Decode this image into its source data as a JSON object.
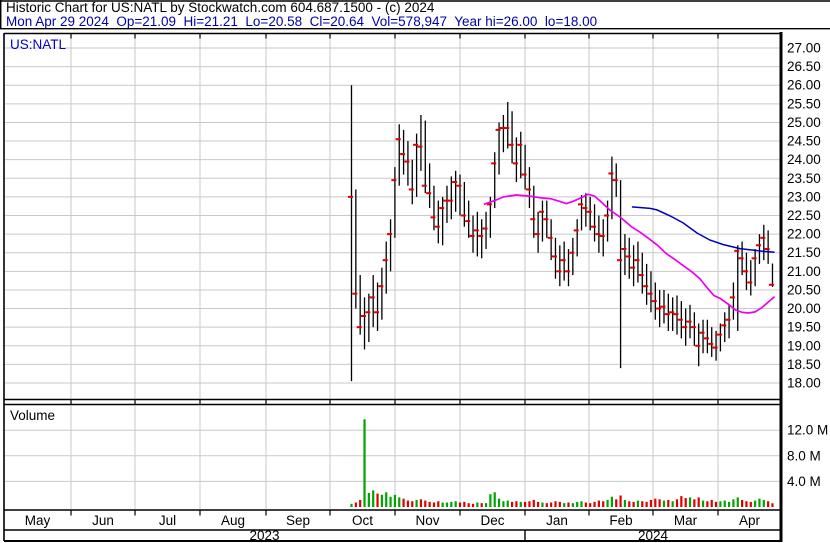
{
  "header": {
    "line1": "Historic Chart for US:NATL by Stockwatch.com 604.687.1500 - (c) 2024",
    "line2": "Mon Apr 29 2024  Op=21.09  Hi=21.21  Lo=20.58  Cl=20.64  Vol=578,947  Year hi=26.00  lo=18.00"
  },
  "chart": {
    "symbol_label": "US:NATL",
    "volume_label": "Volume"
  },
  "colors": {
    "header_line1": "#000000",
    "header_line2": "#0000A8",
    "symbol": "#0000C8",
    "grid": "#C9C9C9",
    "border": "#000000",
    "bar": "#000000",
    "close_tick": "#DD0000",
    "ma_short": "#EE00EE",
    "ma_long": "#0000BB",
    "vol_up": "#00A400",
    "vol_down": "#DC0000",
    "label": "#000000"
  },
  "chart_data": {
    "type": "hlc-bars-with-volume",
    "title": "Historic Chart for US:NATL by Stockwatch.com 604.687.1500 - (c) 2024",
    "subtitle": "Mon Apr 29 2024  Op=21.09  Hi=21.21  Lo=20.58  Cl=20.64  Vol=578,947  Year hi=26.00  lo=18.00",
    "last_quote": {
      "date": "Mon Apr 29 2024",
      "open": 21.09,
      "high": 21.21,
      "low": 20.58,
      "close": 20.64,
      "volume": "578,947",
      "year_high": 26.0,
      "year_low": 18.0
    },
    "price_axis": {
      "min": 18.0,
      "max": 27.0,
      "step": 0.5,
      "side": "right",
      "grid": true
    },
    "volume_axis": {
      "unit": "millions",
      "ticks": [
        {
          "label": "12.0 M",
          "value": 12
        },
        {
          "label": "8.0 M",
          "value": 8
        },
        {
          "label": "4.0 M",
          "value": 4
        }
      ]
    },
    "months": [
      "May",
      "Jun",
      "Jul",
      "Aug",
      "Sep",
      "Oct",
      "Nov",
      "Dec",
      "Jan",
      "Feb",
      "Mar",
      "Apr"
    ],
    "years": [
      {
        "label": "2023",
        "from_month": 0,
        "to_month": 8
      },
      {
        "label": "2024",
        "from_month": 8,
        "to_month": 12
      }
    ],
    "series_note": "trading begins early Oct 2023; bars are high/low lines with red close tick",
    "bars_hi_lo_close": [
      [
        26,
        18.05,
        23
      ],
      [
        23.2,
        20,
        20.4
      ],
      [
        20.9,
        19.3,
        19.5
      ],
      [
        20.3,
        18.9,
        19.8
      ],
      [
        20.4,
        19.1,
        19.9
      ],
      [
        20.9,
        19.5,
        20.3
      ],
      [
        20.7,
        19.4,
        19.9
      ],
      [
        21.1,
        19.7,
        20.6
      ],
      [
        21.8,
        20.4,
        21.3
      ],
      [
        22.4,
        21,
        22
      ],
      [
        23.8,
        21.9,
        23.45
      ],
      [
        24.95,
        23.3,
        24.55
      ],
      [
        24.8,
        23.6,
        24.15
      ],
      [
        24.5,
        23.3,
        23.95
      ],
      [
        24,
        22.8,
        23.2
      ],
      [
        24.7,
        23,
        24.4
      ],
      [
        25.2,
        23.7,
        24.35
      ],
      [
        25.05,
        23.1,
        23.3
      ],
      [
        23.9,
        22.7,
        23.1
      ],
      [
        23.3,
        22.1,
        22.45
      ],
      [
        22.9,
        21.75,
        22.2
      ],
      [
        23,
        21.7,
        22.7
      ],
      [
        23.3,
        22.3,
        22.9
      ],
      [
        23.55,
        22.4,
        22.9
      ],
      [
        23.7,
        22.6,
        23.4
      ],
      [
        23.6,
        22.5,
        23.3
      ],
      [
        23.4,
        22.2,
        22.5
      ],
      [
        22.9,
        21.9,
        22.35
      ],
      [
        22.5,
        21.5,
        21.95
      ],
      [
        22.6,
        21.4,
        22.1
      ],
      [
        22.4,
        21.35,
        21.95
      ],
      [
        22.6,
        21.6,
        22.15
      ],
      [
        23,
        21.9,
        22.8
      ],
      [
        24.2,
        22.7,
        23.9
      ],
      [
        25,
        23.6,
        24.8
      ],
      [
        25.2,
        24.2,
        24.85
      ],
      [
        25.55,
        24.3,
        24.85
      ],
      [
        25.3,
        23.9,
        24.4
      ],
      [
        24.6,
        23.4,
        23.9
      ],
      [
        24.75,
        23.5,
        24.4
      ],
      [
        24.4,
        23.2,
        23.6
      ],
      [
        23.8,
        22.7,
        23.2
      ],
      [
        23.3,
        21.9,
        22.4
      ],
      [
        22.6,
        21.5,
        22
      ],
      [
        22.9,
        21.8,
        22.6
      ],
      [
        22.9,
        21.9,
        22.4
      ],
      [
        22.4,
        21.3,
        21.9
      ],
      [
        21.9,
        20.8,
        21.4
      ],
      [
        21.7,
        20.6,
        21
      ],
      [
        21.8,
        20.75,
        21.3
      ],
      [
        21.6,
        20.6,
        21
      ],
      [
        21.9,
        20.9,
        21.5
      ],
      [
        22.4,
        21.4,
        22.1
      ],
      [
        23.05,
        22.1,
        22.8
      ],
      [
        23.1,
        22.2,
        22.7
      ],
      [
        23,
        22.1,
        22.6
      ],
      [
        22.8,
        21.8,
        22.2
      ],
      [
        22.5,
        21.5,
        22
      ],
      [
        22.4,
        21.4,
        21.95
      ],
      [
        22.9,
        21.8,
        22.5
      ],
      [
        24.08,
        22.4,
        23.63
      ],
      [
        23.9,
        23,
        23.45
      ],
      [
        23.45,
        18.4,
        21.3
      ],
      [
        22,
        20.9,
        21.6
      ],
      [
        21.9,
        20.8,
        21.4
      ],
      [
        21.7,
        20.6,
        21.1
      ],
      [
        21.8,
        20.7,
        21.3
      ],
      [
        21.5,
        20.4,
        20.9
      ],
      [
        21.2,
        20.1,
        20.6
      ],
      [
        21,
        19.9,
        20.4
      ],
      [
        20.7,
        19.7,
        20.2
      ],
      [
        20.5,
        19.5,
        20
      ],
      [
        20.5,
        19.6,
        20.05
      ],
      [
        20.4,
        19.4,
        19.85
      ],
      [
        20.3,
        19.4,
        19.9
      ],
      [
        20.35,
        19.3,
        19.85
      ],
      [
        20.2,
        19.2,
        19.7
      ],
      [
        20,
        19,
        19.5
      ],
      [
        20.1,
        19.2,
        19.65
      ],
      [
        19.9,
        19,
        19.5
      ],
      [
        19.6,
        18.45,
        19
      ],
      [
        19.7,
        18.8,
        19.35
      ],
      [
        19.7,
        18.8,
        19.2
      ],
      [
        19.5,
        18.7,
        19.05
      ],
      [
        19.4,
        18.6,
        18.95
      ],
      [
        19.6,
        18.85,
        19.3
      ],
      [
        19.9,
        19.1,
        19.55
      ],
      [
        20.1,
        19.2,
        19.7
      ],
      [
        20.7,
        19.7,
        20.3
      ],
      [
        21.7,
        19.4,
        21.55
      ],
      [
        21.8,
        20.9,
        21.35
      ],
      [
        21.5,
        20.5,
        21
      ],
      [
        21.3,
        20.35,
        20.7
      ],
      [
        21.6,
        20.6,
        21.35
      ],
      [
        22,
        21.2,
        21.7
      ],
      [
        22.25,
        21.3,
        21.9
      ],
      [
        22.1,
        21.2,
        21.6
      ],
      [
        21.21,
        20.58,
        20.64
      ]
    ],
    "volumes_millions_dir": [
      [
        0.5,
        1
      ],
      [
        0.7,
        0
      ],
      [
        1.1,
        0
      ],
      [
        13.7,
        1
      ],
      [
        2.2,
        1
      ],
      [
        2.6,
        1
      ],
      [
        2.1,
        0
      ],
      [
        1.9,
        1
      ],
      [
        2.3,
        1
      ],
      [
        1.6,
        1
      ],
      [
        1.9,
        1
      ],
      [
        1.5,
        1
      ],
      [
        1.3,
        0
      ],
      [
        1,
        0
      ],
      [
        0.9,
        0
      ],
      [
        1.1,
        1
      ],
      [
        1.2,
        0
      ],
      [
        1,
        0
      ],
      [
        0.8,
        0
      ],
      [
        0.7,
        0
      ],
      [
        0.9,
        0
      ],
      [
        0.7,
        1
      ],
      [
        0.7,
        1
      ],
      [
        0.8,
        1
      ],
      [
        0.9,
        1
      ],
      [
        0.7,
        0
      ],
      [
        0.8,
        0
      ],
      [
        0.6,
        0
      ],
      [
        0.5,
        0
      ],
      [
        0.7,
        1
      ],
      [
        0.6,
        0
      ],
      [
        0.6,
        1
      ],
      [
        2,
        1
      ],
      [
        2.3,
        1
      ],
      [
        1.3,
        1
      ],
      [
        0.9,
        1
      ],
      [
        1,
        1
      ],
      [
        0.8,
        0
      ],
      [
        0.9,
        0
      ],
      [
        0.8,
        1
      ],
      [
        0.8,
        0
      ],
      [
        0.9,
        0
      ],
      [
        1.1,
        0
      ],
      [
        0.8,
        0
      ],
      [
        0.7,
        1
      ],
      [
        0.6,
        0
      ],
      [
        0.7,
        0
      ],
      [
        0.9,
        0
      ],
      [
        0.8,
        0
      ],
      [
        0.6,
        1
      ],
      [
        0.7,
        0
      ],
      [
        0.6,
        1
      ],
      [
        0.8,
        1
      ],
      [
        0.9,
        1
      ],
      [
        0.7,
        0
      ],
      [
        0.6,
        0
      ],
      [
        0.8,
        0
      ],
      [
        1,
        0
      ],
      [
        0.9,
        0
      ],
      [
        1.1,
        1
      ],
      [
        1.6,
        1
      ],
      [
        1.2,
        0
      ],
      [
        1.8,
        0
      ],
      [
        1.1,
        1
      ],
      [
        0.9,
        0
      ],
      [
        0.8,
        0
      ],
      [
        1,
        1
      ],
      [
        0.9,
        0
      ],
      [
        0.8,
        0
      ],
      [
        1.1,
        0
      ],
      [
        1.3,
        0
      ],
      [
        1.2,
        0
      ],
      [
        1,
        1
      ],
      [
        1.1,
        0
      ],
      [
        0.9,
        1
      ],
      [
        1.2,
        0
      ],
      [
        1.7,
        0
      ],
      [
        1.4,
        0
      ],
      [
        1.5,
        1
      ],
      [
        1.2,
        0
      ],
      [
        1.5,
        0
      ],
      [
        1,
        1
      ],
      [
        0.9,
        0
      ],
      [
        1.1,
        0
      ],
      [
        0.8,
        0
      ],
      [
        0.9,
        1
      ],
      [
        1,
        1
      ],
      [
        0.8,
        1
      ],
      [
        1.2,
        1
      ],
      [
        1.5,
        1
      ],
      [
        1.1,
        0
      ],
      [
        0.9,
        0
      ],
      [
        0.8,
        0
      ],
      [
        1,
        1
      ],
      [
        1.3,
        1
      ],
      [
        1.1,
        1
      ],
      [
        0.9,
        0
      ],
      [
        0.58,
        0
      ]
    ],
    "ma_short_points": [
      [
        30.5,
        22.8
      ],
      [
        33,
        22.9
      ],
      [
        35,
        23
      ],
      [
        38,
        23.05
      ],
      [
        41,
        23.02
      ],
      [
        44,
        22.97
      ],
      [
        46,
        22.95
      ],
      [
        48,
        22.88
      ],
      [
        49.5,
        22.82
      ],
      [
        51,
        22.88
      ],
      [
        53,
        22.98
      ],
      [
        54.5,
        23.07
      ],
      [
        56,
        23.02
      ],
      [
        57.5,
        22.87
      ],
      [
        59.5,
        22.65
      ],
      [
        62,
        22.45
      ],
      [
        64.5,
        22.2
      ],
      [
        66.5,
        22.05
      ],
      [
        68.5,
        21.88
      ],
      [
        70.5,
        21.7
      ],
      [
        72.5,
        21.48
      ],
      [
        74.5,
        21.32
      ],
      [
        76.5,
        21.15
      ],
      [
        78.5,
        20.98
      ],
      [
        80.3,
        20.8
      ],
      [
        82,
        20.55
      ],
      [
        83.5,
        20.35
      ],
      [
        85,
        20.27
      ],
      [
        87,
        20.1
      ],
      [
        88.5,
        19.96
      ],
      [
        90,
        19.9
      ],
      [
        91.5,
        19.88
      ],
      [
        93,
        19.91
      ],
      [
        94.5,
        20.02
      ],
      [
        95.7,
        20.14
      ],
      [
        97.5,
        20.32
      ]
    ],
    "ma_long_points": [
      [
        64.6,
        22.73
      ],
      [
        68.8,
        22.69
      ],
      [
        70.4,
        22.65
      ],
      [
        73.4,
        22.49
      ],
      [
        76.4,
        22.3
      ],
      [
        79.6,
        22.03
      ],
      [
        82.6,
        21.84
      ],
      [
        85.6,
        21.72
      ],
      [
        89.5,
        21.61
      ],
      [
        92.5,
        21.57
      ],
      [
        94.8,
        21.54
      ],
      [
        97.5,
        21.51
      ]
    ]
  }
}
